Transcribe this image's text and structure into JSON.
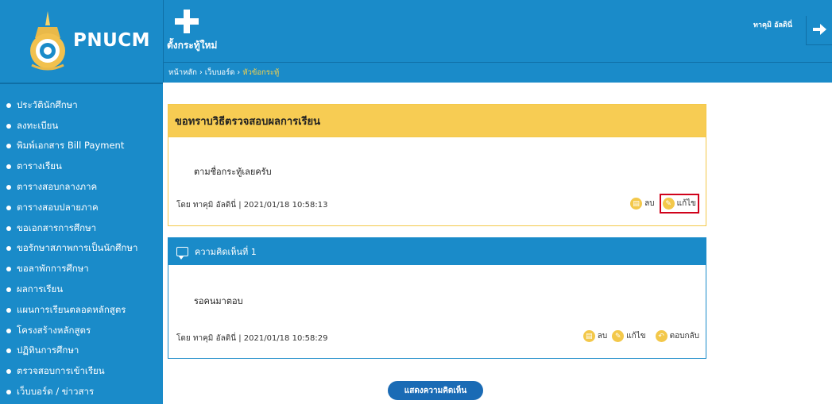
{
  "brand": {
    "name": "PNUCM"
  },
  "header": {
    "new_topic_label": "ตั้งกระทู้ใหม่",
    "user_name": "ทาคุมิ อัลดินี่",
    "breadcrumb": {
      "home": "หน้าหลัก",
      "sep1": " › ",
      "board": "เว็บบอร์ด",
      "sep2": " › ",
      "current": "หัวข้อกระทู้"
    }
  },
  "sidebar": {
    "items": [
      {
        "label": "ประวัตินักศึกษา"
      },
      {
        "label": "ลงทะเบียน"
      },
      {
        "label": "พิมพ์เอกสาร Bill Payment"
      },
      {
        "label": "ตารางเรียน"
      },
      {
        "label": "ตารางสอบกลางภาค"
      },
      {
        "label": "ตารางสอบปลายภาค"
      },
      {
        "label": "ขอเอกสารการศึกษา"
      },
      {
        "label": "ขอรักษาสภาพการเป็นนักศึกษา"
      },
      {
        "label": "ขอลาพักการศึกษา"
      },
      {
        "label": "ผลการเรียน"
      },
      {
        "label": "แผนการเรียนตลอดหลักสูตร"
      },
      {
        "label": "โครงสร้างหลักสูตร"
      },
      {
        "label": "ปฏิทินการศึกษา"
      },
      {
        "label": "ตรวจสอบการเข้าเรียน"
      },
      {
        "label": "เว็บบอร์ด / ข่าวสาร"
      }
    ]
  },
  "post": {
    "title": "ขอทราบวิธีตรวจสอบผลการเรียน",
    "body": "ตามชื่อกระทู้เลยครับ",
    "meta": "โดย ทาคุมิ อัลดินี่ | 2021/01/18 10:58:13",
    "delete_label": "ลบ",
    "edit_label": "แก้ไข"
  },
  "comment": {
    "header": "ความคิดเห็นที่ 1",
    "body": "รอคนมาตอบ",
    "meta": "โดย ทาคุมิ อัลดินี่ | 2021/01/18 10:58:29",
    "delete_label": "ลบ",
    "edit_label": "แก้ไข",
    "reply_label": "ตอบกลับ"
  },
  "show_comment_button": "แสดงความคิดเห็น",
  "colors": {
    "primary": "#1a8bc9",
    "post_header": "#f7cc53",
    "highlight": "#d0021b"
  }
}
